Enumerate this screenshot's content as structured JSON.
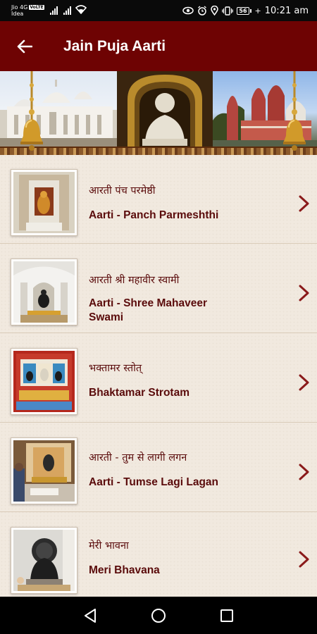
{
  "status_bar": {
    "carrier_top": "Jio 4G",
    "volte": "VoLTE",
    "carrier_bottom": "Idea",
    "battery": "56",
    "time": "10:21 am"
  },
  "app_bar": {
    "title": "Jain Puja Aarti"
  },
  "aarti_list": [
    {
      "hindi": "आरती पंच परमेष्ठी",
      "english": "Aarti - Panch Parmeshthi"
    },
    {
      "hindi": "आरती श्री महावीर स्वामी",
      "english": "Aarti - Shree Mahaveer Swami"
    },
    {
      "hindi": "भक्तामर स्तोत्",
      "english": "Bhaktamar Strotam"
    },
    {
      "hindi": "आरती - तुम से लागी लगन",
      "english": "Aarti - Tumse Lagi Lagan"
    },
    {
      "hindi": "मेरी भावना",
      "english": "Meri Bhavana"
    }
  ],
  "colors": {
    "app_bar": "#6e0303",
    "text": "#5a0b0b",
    "chevron": "#8a1a1a",
    "list_bg": "#f1e9df"
  },
  "icons": {
    "back": "arrow-left-icon",
    "chevron": "chevron-right-icon",
    "nav_back": "triangle-back-icon",
    "nav_home": "circle-home-icon",
    "nav_recents": "square-recents-icon"
  }
}
